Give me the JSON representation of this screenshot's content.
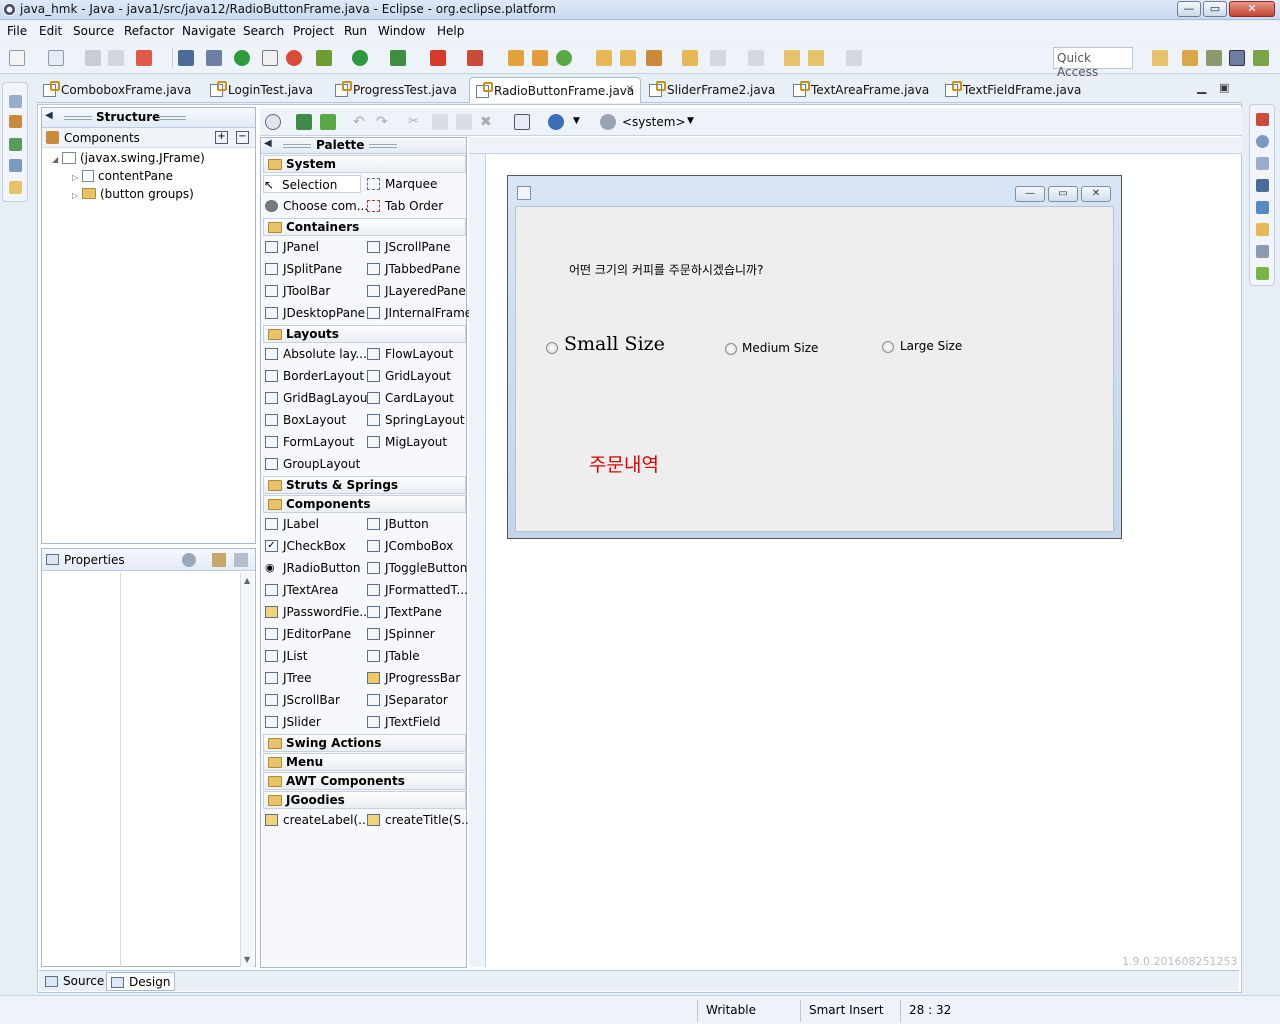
{
  "window": {
    "title": "java_hmk - Java - java1/src/java12/RadioButtonFrame.java - Eclipse - org.eclipse.platform",
    "minimize": "—",
    "maximize": "▭",
    "close": "✕"
  },
  "menu": [
    "File",
    "Edit",
    "Source",
    "Refactor",
    "Navigate",
    "Search",
    "Project",
    "Run",
    "Window",
    "Help"
  ],
  "toolbar": {
    "quick_access_placeholder": "Quick Access"
  },
  "editor_tabs": [
    {
      "label": "ComboboxFrame.java"
    },
    {
      "label": "LoginTest.java"
    },
    {
      "label": "ProgressTest.java"
    },
    {
      "label": "RadioButtonFrame.java",
      "active": true
    },
    {
      "label": "SliderFrame2.java"
    },
    {
      "label": "TextAreaFrame.java"
    },
    {
      "label": "TextFieldFrame.java"
    }
  ],
  "structure": {
    "title": "Structure",
    "components_label": "Components",
    "tree": [
      "(javax.swing.JFrame)",
      "contentPane",
      "(button groups)"
    ]
  },
  "properties": {
    "title": "Properties"
  },
  "palette": {
    "title": "Palette",
    "categories": {
      "system": "System",
      "containers": "Containers",
      "layouts": "Layouts",
      "struts": "Struts & Springs",
      "components": "Components",
      "swing_actions": "Swing Actions",
      "menu": "Menu",
      "awt": "AWT Components",
      "jgoodies": "JGoodies"
    },
    "system_items": [
      "Selection",
      "Marquee",
      "Choose com...",
      "Tab Order"
    ],
    "container_items": [
      "JPanel",
      "JScrollPane",
      "JSplitPane",
      "JTabbedPane",
      "JToolBar",
      "JLayeredPane",
      "JDesktopPane",
      "JInternalFrame"
    ],
    "layout_items": [
      "Absolute lay...",
      "FlowLayout",
      "BorderLayout",
      "GridLayout",
      "GridBagLayout",
      "CardLayout",
      "BoxLayout",
      "SpringLayout",
      "FormLayout",
      "MigLayout",
      "GroupLayout"
    ],
    "component_items": [
      "JLabel",
      "JButton",
      "JCheckBox",
      "JComboBox",
      "JRadioButton",
      "JToggleButton",
      "JTextArea",
      "JFormattedT...",
      "JPasswordFie...",
      "JTextPane",
      "JEditorPane",
      "JSpinner",
      "JList",
      "JTable",
      "JTree",
      "JProgressBar",
      "JScrollBar",
      "JSeparator",
      "JSlider",
      "JTextField"
    ],
    "jgoodies_items": [
      "createLabel(...",
      "createTitle(S..."
    ]
  },
  "designer_toolbar": {
    "system_label": "<system>"
  },
  "design_frame": {
    "question": "어떤 크기의 커피를 주문하시겠습니까?",
    "radio_small": "Small Size",
    "radio_medium": "Medium Size",
    "radio_large": "Large Size",
    "order_label": "주문내역",
    "order_color": "#e00000"
  },
  "version_text": "1.9.0.201608251253",
  "bottom_tabs": [
    "Source",
    "Design"
  ],
  "status": {
    "writable": "Writable",
    "insert_mode": "Smart Insert",
    "position": "28 : 32"
  }
}
